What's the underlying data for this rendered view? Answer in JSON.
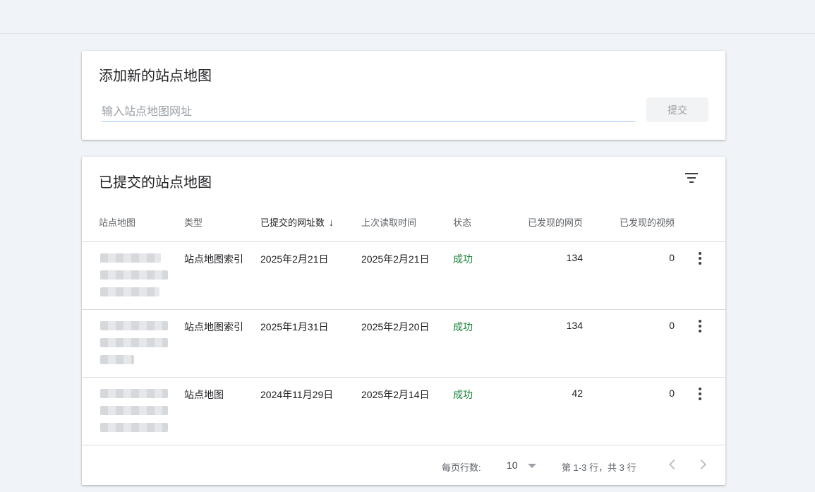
{
  "add_card": {
    "title": "添加新的站点地图",
    "input_placeholder": "输入站点地图网址",
    "input_value": "",
    "submit_label": "提交"
  },
  "list_card": {
    "title": "已提交的站点地图",
    "filter_icon": "filter-icon",
    "columns": {
      "sitemap": "站点地图",
      "type": "类型",
      "submitted": "已提交的网址数",
      "last_read": "上次读取时间",
      "status": "状态",
      "discovered_pages": "已发现的网页",
      "discovered_videos": "已发现的视频"
    },
    "sort_icon": "arrow-down-icon",
    "rows": [
      {
        "type": "站点地图索引",
        "submitted": "2025年2月21日",
        "last_read": "2025年2月21日",
        "status": "成功",
        "pages": "134",
        "videos": "0"
      },
      {
        "type": "站点地图索引",
        "submitted": "2025年1月31日",
        "last_read": "2025年2月20日",
        "status": "成功",
        "pages": "134",
        "videos": "0"
      },
      {
        "type": "站点地图",
        "submitted": "2024年11月29日",
        "last_read": "2025年2月14日",
        "status": "成功",
        "pages": "42",
        "videos": "0"
      }
    ],
    "footer": {
      "rows_per_page_label": "每页行数:",
      "rows_per_page_value": "10",
      "range_text": "第 1-3 行，共 3 行"
    }
  },
  "colors": {
    "status_success": "#188038",
    "background": "#f0f3f7"
  }
}
